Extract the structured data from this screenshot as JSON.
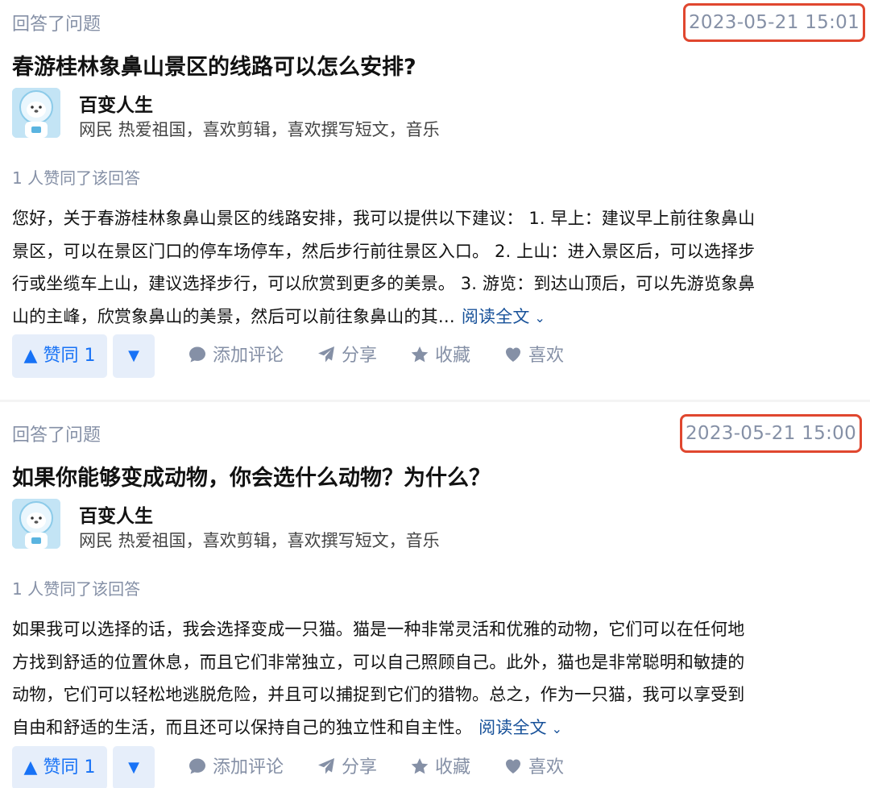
{
  "answers": [
    {
      "meta": "回答了问题",
      "time": "2023-05-21 15:01",
      "question": "春游桂林象鼻山景区的线路可以怎么安排?",
      "author_name": "百变人生",
      "author_bio": "网民 热爱祖国，喜欢剪辑，喜欢撰写短文，音乐",
      "votes_line": "1 人赞同了该回答",
      "lines": [
        "您好，关于春游桂林象鼻山景区的线路安排，我可以提供以下建议： 1. 早上：建议早上前往象鼻山",
        "景区，可以在景区门口的停车场停车，然后步行前往景区入口。 2. 上山：进入景区后，可以选择步",
        "行或坐缆车上山，建议选择步行，可以欣赏到更多的美景。 3. 游览：到达山顶后，可以先游览象鼻",
        "山的主峰，欣赏象鼻山的美景，然后可以前往象鼻山的其…"
      ],
      "read_more": "阅读全文",
      "vote_label": "▲ 赞同 1",
      "down_label": "▼",
      "comment_label": "添加评论",
      "share_label": "分享",
      "fav_label": "收藏",
      "like_label": "喜欢"
    },
    {
      "meta": "回答了问题",
      "time": "2023-05-21 15:00",
      "question": "如果你能够变成动物，你会选什么动物？为什么？",
      "author_name": "百变人生",
      "author_bio": "网民 热爱祖国，喜欢剪辑，喜欢撰写短文，音乐",
      "votes_line": "1 人赞同了该回答",
      "lines": [
        "如果我可以选择的话，我会选择变成一只猫。猫是一种非常灵活和优雅的动物，它们可以在任何地",
        "方找到舒适的位置休息，而且它们非常独立，可以自己照顾自己。此外，猫也是非常聪明和敏捷的",
        "动物，它们可以轻松地逃脱危险，并且可以捕捉到它们的猎物。总之，作为一只猫，我可以享受到",
        "自由和舒适的生活，而且还可以保持自己的独立性和自主性。"
      ],
      "read_more": "阅读全文",
      "vote_label": "▲ 赞同 1",
      "down_label": "▼",
      "comment_label": "添加评论",
      "share_label": "分享",
      "fav_label": "收藏",
      "like_label": "喜欢"
    }
  ],
  "icons": {
    "comment": "comment-icon",
    "share": "paper-plane-icon",
    "fav": "star-icon",
    "like": "heart-icon",
    "chevron": "chevron-down-icon"
  },
  "colors": {
    "highlight_box": "#e0472f",
    "accent": "#1772f6",
    "link": "#175199",
    "muted": "#8590a6"
  }
}
